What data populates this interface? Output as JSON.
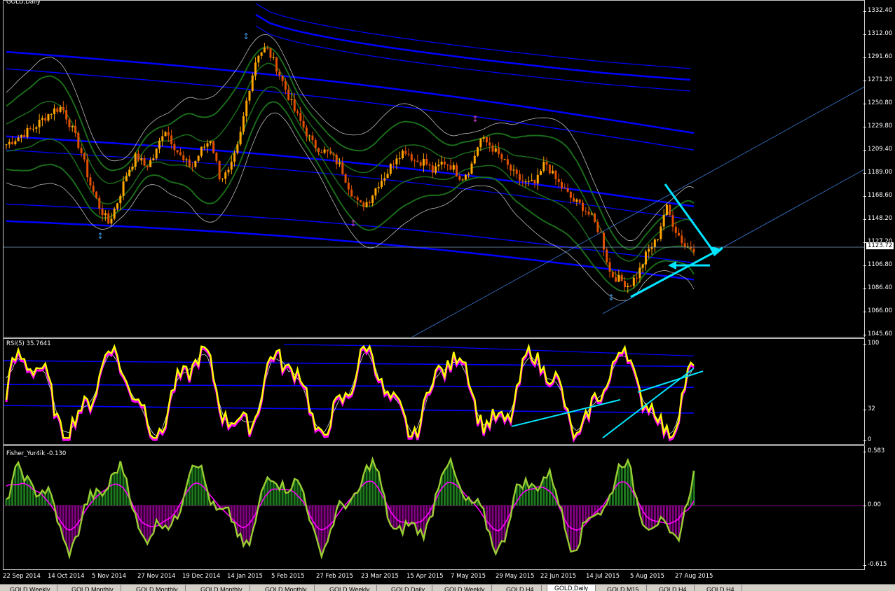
{
  "chart_title": "GOLD,Daily",
  "current_price": "1123.72",
  "price_axis": [
    "1332.40",
    "1312.00",
    "1291.60",
    "1271.20",
    "1250.80",
    "1229.80",
    "1209.40",
    "1189.00",
    "1168.60",
    "1148.20",
    "1127.20",
    "1106.80",
    "1086.40",
    "1066.00",
    "1045.60"
  ],
  "rsi_label": "RSI(5) 35.7641",
  "rsi_axis": [
    "100",
    "32",
    "0"
  ],
  "fisher_label": "Fisher_Yur4ik -0.130",
  "fisher_axis": [
    "0.583",
    "0.00",
    "-0.615"
  ],
  "date_axis": [
    "22 Sep 2014",
    "14 Oct 2014",
    "5 Nov 2014",
    "27 Nov 2014",
    "19 Dec 2014",
    "14 Jan 2015",
    "5 Feb 2015",
    "27 Feb 2015",
    "23 Mar 2015",
    "15 Apr 2015",
    "7 May 2015",
    "29 May 2015",
    "22 Jun 2015",
    "14 Jul 2015",
    "5 Aug 2015",
    "27 Aug 2015"
  ],
  "tabs": [
    "GOLD,Weekly",
    "GOLD,Monthly",
    "GOLD,Monthly",
    "GOLD,Monthly",
    "GOLD,Monthly",
    "GOLD,Weekly",
    "GOLD,Daily",
    "GOLD,Weekly",
    "GOLD,H4",
    "GOLD,Daily",
    "GOLD,M15",
    "GOLD,H4",
    "GOLD,H4"
  ],
  "active_tab": 9,
  "colors": {
    "candle_bull": "#ffa500",
    "candle_bear": "#e05000",
    "channel": "#0000ff",
    "bands": "#1a6b1a",
    "envelope": "#bbbbbb",
    "trend": "#00e5ff",
    "rsi": "#ffff00",
    "rsi_shadow": "#ff00ff",
    "fisher_line": "#9acd32",
    "fisher_signal": "#ff00ff",
    "hist_up": "#1e7a1e",
    "hist_down": "#800080"
  },
  "chart_data": {
    "type": "line",
    "title": "GOLD,Daily",
    "close_series_approx": [
      1215,
      1220,
      1225,
      1230,
      1238,
      1245,
      1248,
      1230,
      1210,
      1180,
      1160,
      1145,
      1165,
      1190,
      1205,
      1195,
      1205,
      1230,
      1215,
      1200,
      1195,
      1210,
      1220,
      1185,
      1190,
      1215,
      1260,
      1295,
      1300,
      1285,
      1265,
      1245,
      1230,
      1215,
      1210,
      1205,
      1195,
      1175,
      1160,
      1165,
      1180,
      1190,
      1205,
      1210,
      1200,
      1200,
      1190,
      1200,
      1195,
      1185,
      1195,
      1220,
      1215,
      1205,
      1195,
      1185,
      1180,
      1180,
      1200,
      1185,
      1175,
      1165,
      1160,
      1150,
      1135,
      1100,
      1095,
      1090,
      1100,
      1120,
      1130,
      1160,
      1140,
      1125,
      1123
    ],
    "ylim": [
      1045.6,
      1332.4
    ]
  }
}
